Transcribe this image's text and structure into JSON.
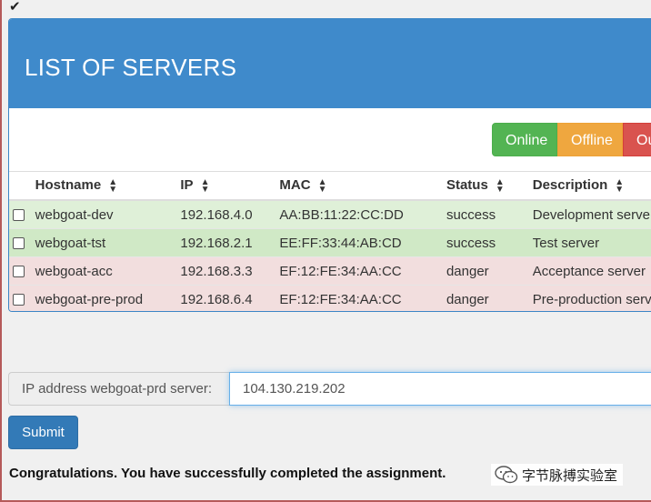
{
  "header": {
    "title": "LIST OF SERVERS"
  },
  "filters": {
    "online": "Online",
    "offline": "Offline",
    "out": "Out"
  },
  "table": {
    "columns": [
      "Hostname",
      "IP",
      "MAC",
      "Status",
      "Description"
    ],
    "rows": [
      {
        "hostname": "webgoat-dev",
        "ip": "192.168.4.0",
        "mac": "AA:BB:11:22:CC:DD",
        "status": "success",
        "description": "Development server"
      },
      {
        "hostname": "webgoat-tst",
        "ip": "192.168.2.1",
        "mac": "EE:FF:33:44:AB:CD",
        "status": "success",
        "description": "Test server"
      },
      {
        "hostname": "webgoat-acc",
        "ip": "192.168.3.3",
        "mac": "EF:12:FE:34:AA:CC",
        "status": "danger",
        "description": "Acceptance server"
      },
      {
        "hostname": "webgoat-pre-prod",
        "ip": "192.168.6.4",
        "mac": "EF:12:FE:34:AA:CC",
        "status": "danger",
        "description": "Pre-production server"
      }
    ]
  },
  "form": {
    "label": "IP address webgoat-prd server:",
    "value": "104.130.219.202",
    "submit": "Submit"
  },
  "message": "Congratulations. You have successfully completed the assignment.",
  "watermark": {
    "text": "字节脉搏实验室"
  },
  "icons": {
    "check": "check-icon",
    "sort": "sort-icon",
    "wechat": "wechat-icon"
  },
  "colors": {
    "header": "#3f8acb",
    "online": "#53b453",
    "offline": "#efa73f",
    "out": "#d9534f",
    "submit": "#337ab7"
  }
}
